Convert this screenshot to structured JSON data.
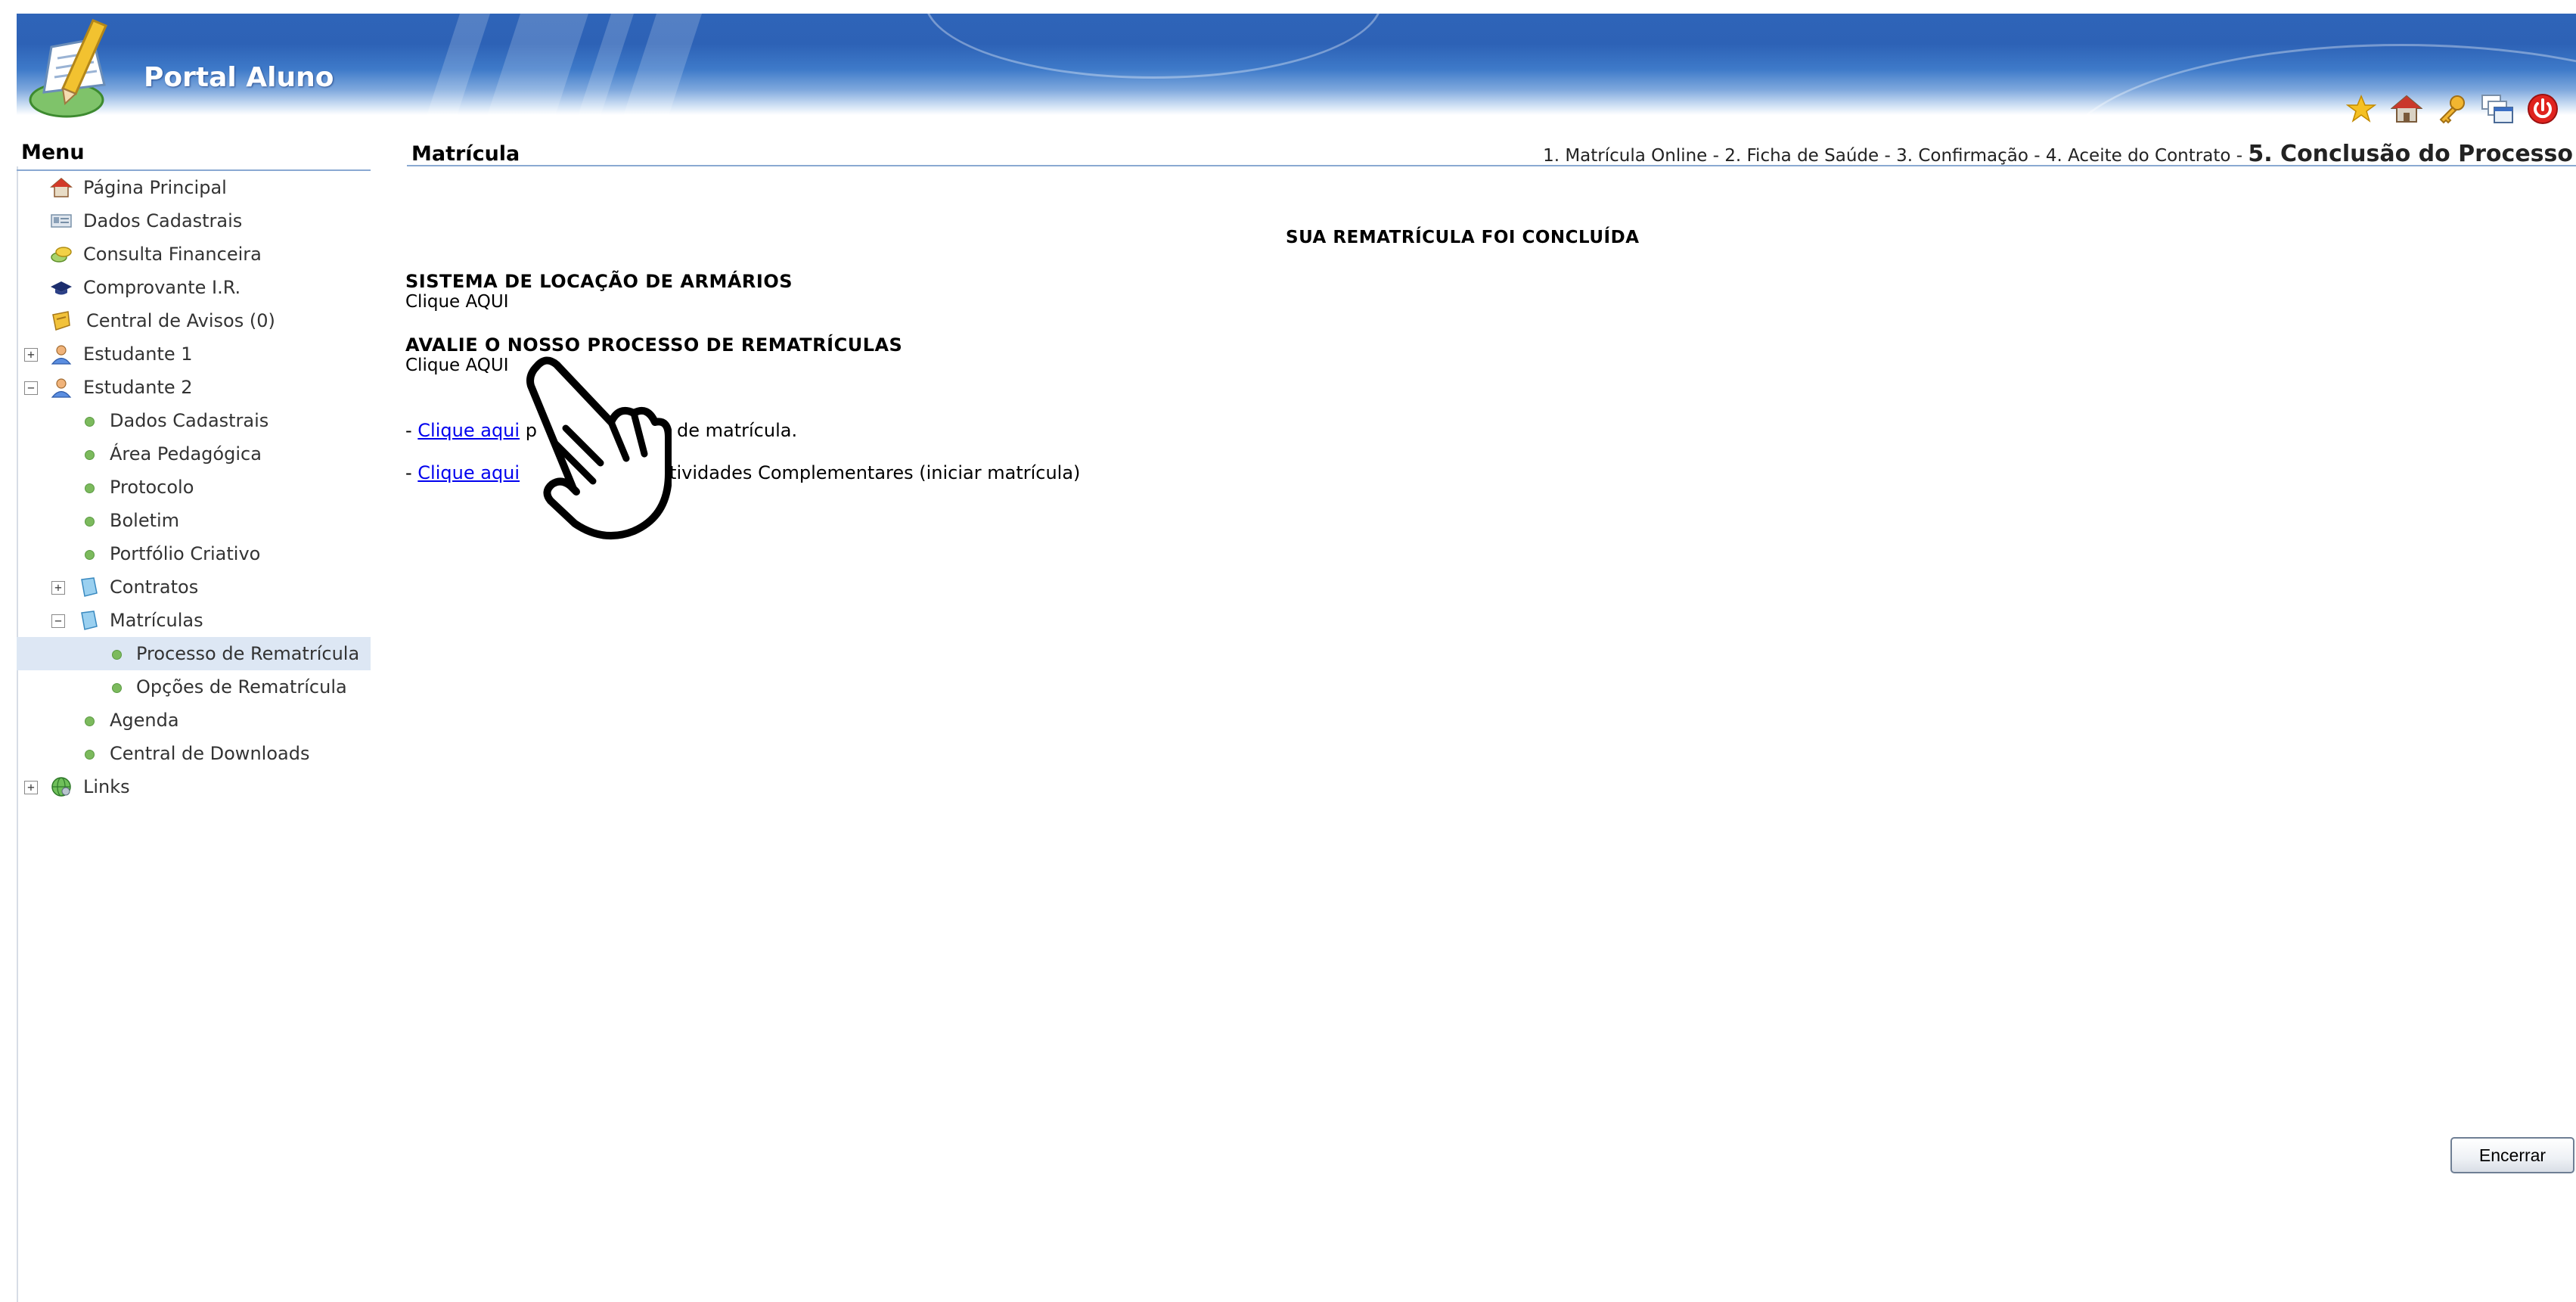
{
  "app": {
    "title": "Portal Aluno"
  },
  "header_icons": [
    {
      "name": "favorites-star-icon"
    },
    {
      "name": "home-icon"
    },
    {
      "name": "key-icon"
    },
    {
      "name": "windows-icon"
    },
    {
      "name": "power-icon"
    }
  ],
  "menu": {
    "title": "Menu",
    "items": [
      {
        "label": "Página Principal"
      },
      {
        "label": "Dados Cadastrais"
      },
      {
        "label": "Consulta Financeira"
      },
      {
        "label": "Comprovante I.R."
      },
      {
        "label": "Central de Avisos (0)"
      },
      {
        "label": "Estudante 1"
      },
      {
        "label": "Estudante 2"
      },
      {
        "label": "Dados Cadastrais"
      },
      {
        "label": "Área Pedagógica"
      },
      {
        "label": "Protocolo"
      },
      {
        "label": "Boletim"
      },
      {
        "label": "Portfólio Criativo"
      },
      {
        "label": "Contratos"
      },
      {
        "label": "Matrículas"
      },
      {
        "label": "Processo de Rematrícula"
      },
      {
        "label": "Opções de Rematrícula"
      },
      {
        "label": "Agenda"
      },
      {
        "label": "Central de Downloads"
      },
      {
        "label": "Links"
      }
    ]
  },
  "main": {
    "title": "Matrícula",
    "steps": {
      "prefix": "1. Matrícula Online - 2. Ficha de Saúde - 3. Confirmação - 4. Aceite do Contrato - ",
      "current": "5. Conclusão do Processo"
    },
    "done_message": "SUA REMATRÍCULA FOI CONCLUÍDA",
    "lockers": {
      "title": "SISTEMA DE LOCAÇÃO DE ARMÁRIOS",
      "link": "Clique AQUI"
    },
    "evaluate": {
      "title": "AVALIE O NOSSO PROCESSO DE REMATRÍCULAS",
      "link": "Clique AQUI"
    },
    "line1": {
      "prefix": "- ",
      "link": "Clique aqui",
      "suffix": " p          contrato de matrícula."
    },
    "line2": {
      "prefix": "- ",
      "link": "Clique aqui",
      "suffix": "               r nas Atividades Complementares (iniciar matrícula)"
    },
    "close_button": "Encerrar"
  },
  "cursor": {
    "name": "hand-pointer-cursor-icon"
  }
}
